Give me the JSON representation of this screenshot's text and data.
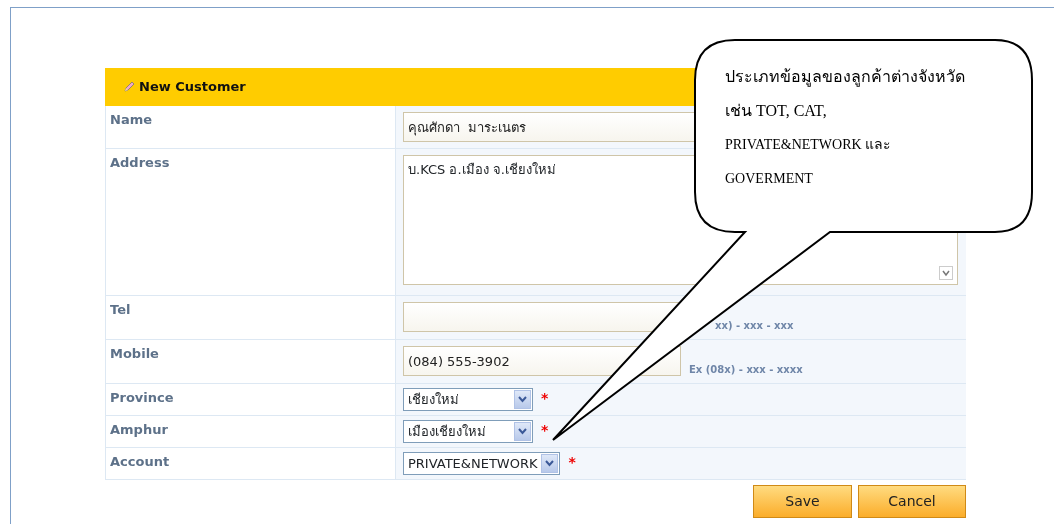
{
  "form": {
    "title": "New Customer",
    "fields": [
      {
        "label": "Name",
        "kind": "text",
        "value": "คุณศักดา  มาระเนตร"
      },
      {
        "label": "Address",
        "kind": "textarea",
        "value": "บ.KCS อ.เมือง จ.เชียงใหม่"
      },
      {
        "label": "Tel",
        "kind": "text",
        "hint": "xx) - xxx - xxx"
      },
      {
        "label": "Mobile",
        "kind": "text",
        "value": "(084) 555-3902",
        "hint": "Ex (08x) - xxx - xxxx"
      },
      {
        "label": "Province",
        "kind": "select",
        "value": "เชียงใหม่",
        "required_mark": "*"
      },
      {
        "label": "Amphur",
        "kind": "select",
        "value": "เมืองเชียงใหม่",
        "required_mark": "*"
      },
      {
        "label": "Account",
        "kind": "select",
        "value": "PRIVATE&NETWORK",
        "required_mark": "*"
      }
    ]
  },
  "buttons": [
    {
      "label": "Save"
    },
    {
      "label": "Cancel"
    }
  ],
  "callout": {
    "lines": [
      "ประเภทข้อมูลของลูกค้าต่างจังหวัด",
      "เช่น TOT, CAT,",
      "PRIVATE&NETWORK และ",
      "GOVERMENT"
    ]
  }
}
